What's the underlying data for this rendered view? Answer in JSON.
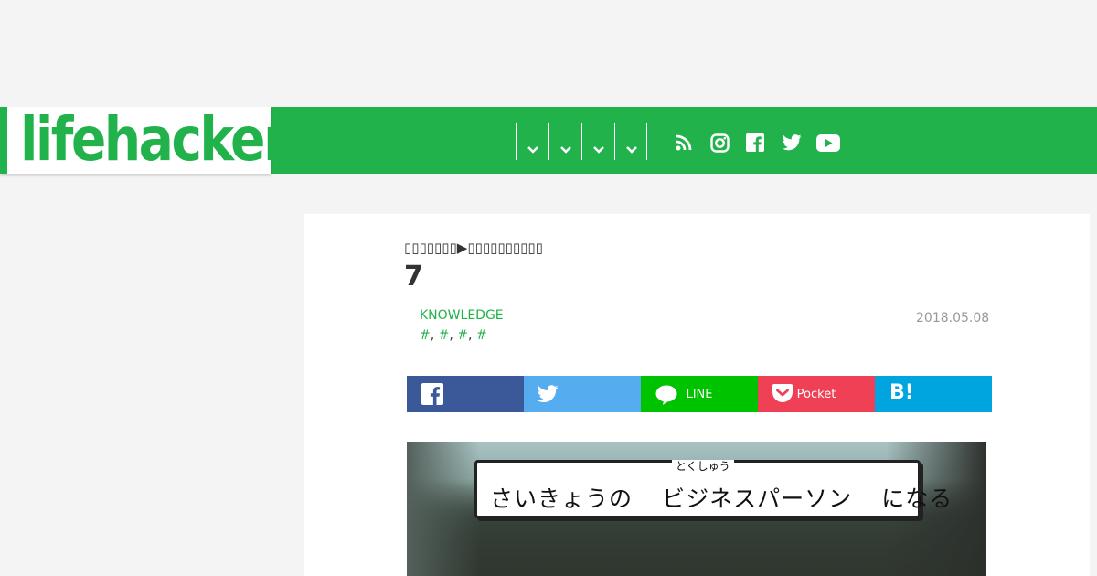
{
  "header": {
    "logo_text": "lifehacker",
    "brand_color": "#21b24b",
    "nav_menu_icons": [
      "chevron-down-icon",
      "chevron-down-icon",
      "chevron-down-icon",
      "chevron-down-icon"
    ],
    "social_icons": [
      "rss-icon",
      "instagram-icon",
      "facebook-icon",
      "twitter-icon",
      "youtube-icon"
    ]
  },
  "article": {
    "breadcrumb": "▯▯▯▯▯▯▯▶▯▯▯▯▯▯▯▯▯▯",
    "title": "7",
    "category": "KNOWLEDGE",
    "tags": [
      "#",
      "#",
      "#",
      "#"
    ],
    "date": "2018.05.08"
  },
  "share": {
    "facebook_icon": "facebook-icon",
    "twitter_icon": "twitter-icon",
    "line_label": "LINE",
    "pocket_label": "Pocket",
    "hatena_label": "B!",
    "colors": {
      "facebook": "#3b5998",
      "twitter": "#55acee",
      "line": "#00c300",
      "pocket": "#ef4056",
      "hatena": "#00a4de"
    }
  },
  "hero": {
    "ruby": "とくしゅう",
    "caption": "さいきょうの  ビジネスパーソン  になる"
  }
}
